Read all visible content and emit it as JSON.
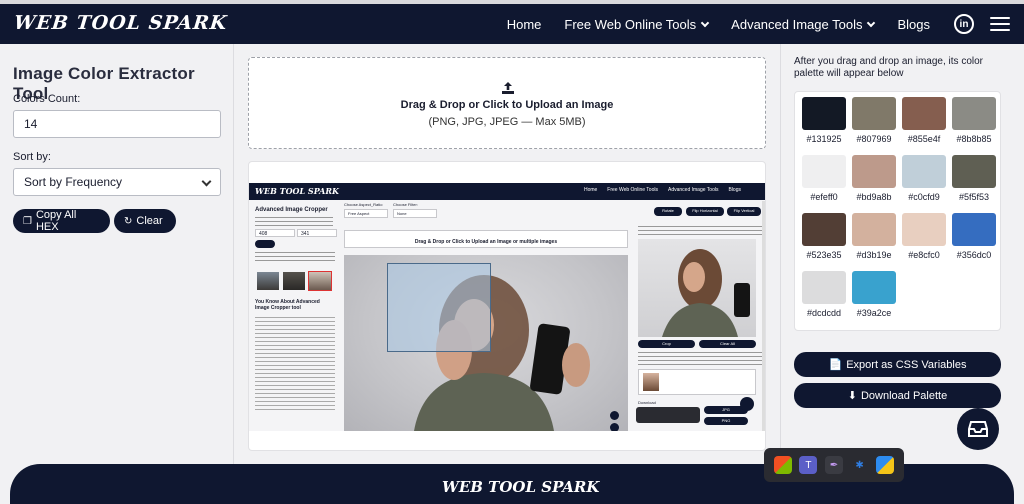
{
  "header": {
    "logo": "WEB TOOL SPARK",
    "nav": [
      "Home",
      "Free Web Online Tools",
      "Advanced Image Tools",
      "Blogs"
    ]
  },
  "left_panel": {
    "title": "Image Color Extractor Tool",
    "colors_count_label": "Colors Count:",
    "colors_count_value": "14",
    "sort_label": "Sort by:",
    "sort_value": "Sort by Frequency",
    "copy_button": "Copy All HEX",
    "clear_button": "Clear"
  },
  "upload": {
    "title": "Drag & Drop or Click to Upload an Image",
    "subtitle": "(PNG, JPG, JPEG — Max 5MB)"
  },
  "preview": {
    "logo": "WEB TOOL SPARK",
    "nav": [
      "Home",
      "Free Web Online Tools",
      "Advanced Image Tools",
      "Blogs"
    ],
    "tool_title": "Advanced Image Cropper",
    "aspect_label": "Choose Aspect_Ratio",
    "aspect_value": "Free Aspect",
    "filter_label": "Choose Filter:",
    "filter_value": "None",
    "upload_text": "Drag & Drop or Click to Upload an Image or multiple images",
    "width_value": "408",
    "height_value": "341",
    "about_title": "You Know About Advanced Image Cropper tool",
    "btn_rotate": "Rotate",
    "btn_flip_h": "Flip Horizontal",
    "btn_flip_v": "Flip Vertical",
    "btn_crop": "Crop",
    "btn_clear": "Clear All",
    "download_label": "Download",
    "btn_jpg": "JPG",
    "btn_png": "PNG"
  },
  "right_panel": {
    "note": "After you drag and drop an image, its color palette will appear below",
    "swatches": [
      "#131925",
      "#807969",
      "#855e4f",
      "#8b8b85",
      "#efeff0",
      "#bd9a8b",
      "#c0cfd9",
      "#5f5f53",
      "#523e35",
      "#d3b19e",
      "#e8cfc0",
      "#356dc0",
      "#dcdcdd",
      "#39a2ce"
    ],
    "export_button": "Export as CSS Variables",
    "download_button": "Download Palette"
  },
  "footer": {
    "logo": "WEB TOOL SPARK"
  }
}
